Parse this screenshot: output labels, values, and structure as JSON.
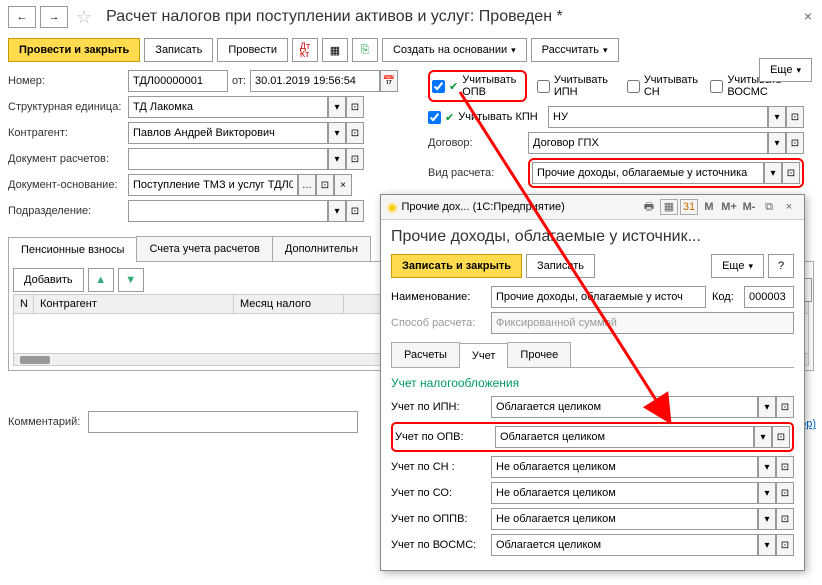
{
  "header": {
    "title": "Расчет налогов при поступлении активов и услуг: Проведен *"
  },
  "toolbar": {
    "post_close": "Провести и закрыть",
    "write": "Записать",
    "post": "Провести",
    "create_based": "Создать на основании",
    "calc": "Рассчитать",
    "more": "Еще"
  },
  "fields": {
    "number_lbl": "Номер:",
    "number": "ТДЛ00000001",
    "from_lbl": "от:",
    "date": "30.01.2019 19:56:54",
    "unit_lbl": "Структурная единица:",
    "unit": "ТД Лакомка",
    "counterparty_lbl": "Контрагент:",
    "counterparty": "Павлов Андрей Викторович",
    "doc_calc_lbl": "Документ расчетов:",
    "doc_base_lbl": "Документ-основание:",
    "doc_base": "Поступление ТМЗ и услуг ТДЛ0",
    "subdiv_lbl": "Подразделение:",
    "chk_opv": "Учитывать ОПВ",
    "chk_ipn": "Учитывать ИПН",
    "chk_sn": "Учитывать СН",
    "chk_vosms": "Учитывать ВОСМС",
    "chk_kpn": "Учитывать КПН",
    "kpn_val": "НУ",
    "contract_lbl": "Договор:",
    "contract": "Договор ГПХ",
    "calc_type_lbl": "Вид расчета:",
    "calc_type": "Прочие доходы, облагаемые у источника"
  },
  "tabs": {
    "t1": "Пенсионные взносы",
    "t2": "Счета учета расчетов",
    "t3": "Дополнительн"
  },
  "grid": {
    "add": "Добавить",
    "col_n": "N",
    "col_contr": "Контрагент",
    "col_month": "Месяц налого"
  },
  "comment_lbl": "Комментарий:",
  "admin_link": "нистратор)",
  "modal": {
    "win_title": "Прочие дох... (1С:Предприятие)",
    "title": "Прочие доходы, облагаемые у источник...",
    "write_close": "Записать и закрыть",
    "write": "Записать",
    "more": "Еще",
    "name_lbl": "Наименование:",
    "name": "Прочие доходы, облагаемые у источ",
    "code_lbl": "Код:",
    "code": "000003",
    "method_lbl": "Способ расчета:",
    "method": "Фиксированной суммой",
    "tab_calc": "Расчеты",
    "tab_acct": "Учет",
    "tab_other": "Прочее",
    "sec_title": "Учет налогообложения",
    "rows": [
      {
        "lbl": "Учет по ИПН:",
        "val": "Облагается целиком"
      },
      {
        "lbl": "Учет по ОПВ:",
        "val": "Облагается целиком"
      },
      {
        "lbl": "Учет по СН :",
        "val": "Не облагается целиком"
      },
      {
        "lbl": "Учет по СО:",
        "val": "Не облагается целиком"
      },
      {
        "lbl": "Учет по ОППВ:",
        "val": "Не облагается целиком"
      },
      {
        "lbl": "Учет по ВОСМС:",
        "val": "Облагается целиком"
      }
    ]
  }
}
